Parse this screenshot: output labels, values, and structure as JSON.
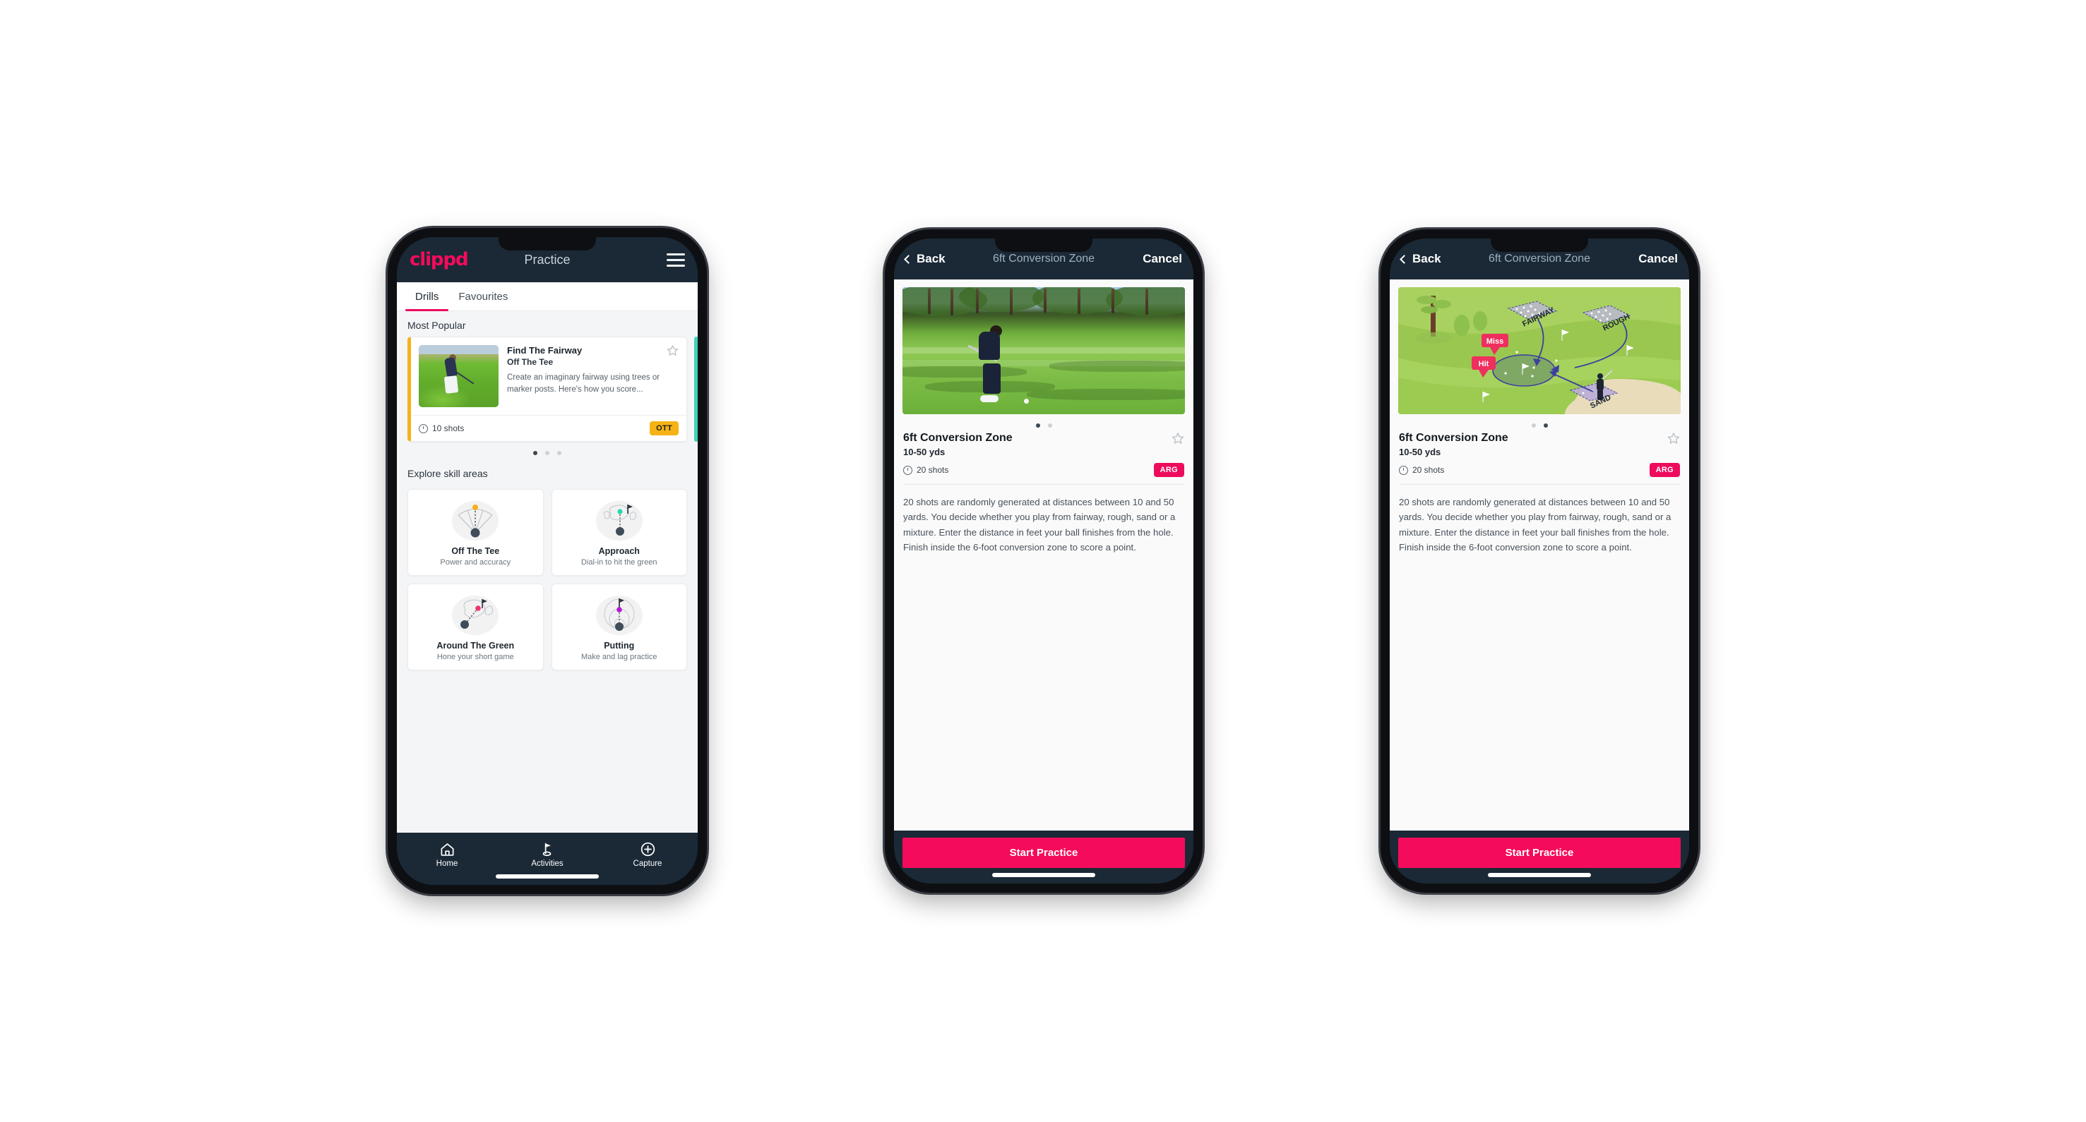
{
  "app": {
    "brand": "clippd",
    "title": "Practice",
    "accent_pink": "#f50b5b",
    "header_navy": "#1b2936",
    "badge_yellow": "#f6b316",
    "badge_pink": "#ee0b5d",
    "teal": "#3fd2b6"
  },
  "phone1": {
    "appbar": {
      "logo": "clippd",
      "title": "Practice",
      "menu_icon": "hamburger-icon"
    },
    "tabs": [
      {
        "label": "Drills",
        "active": true
      },
      {
        "label": "Favourites",
        "active": false
      }
    ],
    "most_popular": {
      "heading": "Most Popular",
      "card": {
        "name": "Find The Fairway",
        "category": "Off The Tee",
        "description": "Create an imaginary fairway using trees or marker posts. Here's how you score...",
        "shots": "10 shots",
        "badge": "OTT",
        "favourite_icon": "star-outline-icon",
        "accent": "#f5b21a"
      },
      "pagination": {
        "count": 3,
        "active_index": 0
      }
    },
    "skills": {
      "heading": "Explore skill areas",
      "items": [
        {
          "name": "Off The Tee",
          "sub": "Power and accuracy",
          "icon": "tee-fan-icon",
          "dot_color": "#f7ae18"
        },
        {
          "name": "Approach",
          "sub": "Dial-in to hit the green",
          "icon": "green-target-icon",
          "dot_color": "#27d8b0"
        },
        {
          "name": "Around The Green",
          "sub": "Hone your short game",
          "icon": "chip-green-icon",
          "dot_color": "#f0336b"
        },
        {
          "name": "Putting",
          "sub": "Make and lag practice",
          "icon": "putt-rings-icon",
          "dot_color": "#b41ad6"
        }
      ]
    },
    "tabbar": [
      {
        "label": "Home",
        "icon": "home-icon",
        "active": false
      },
      {
        "label": "Activities",
        "icon": "golf-flag-icon",
        "active": true
      },
      {
        "label": "Capture",
        "icon": "plus-circle-icon",
        "active": false
      }
    ]
  },
  "phone2": {
    "navbar": {
      "back": "Back",
      "title": "6ft Conversion Zone",
      "cancel": "Cancel",
      "back_icon": "chevron-left-icon"
    },
    "media": {
      "type": "video-still",
      "alt": "golfer chipping on fairway"
    },
    "pagination": {
      "count": 2,
      "active_index": 0
    },
    "detail": {
      "title": "6ft Conversion Zone",
      "subtitle": "10-50 yds",
      "shots": "20 shots",
      "badge": "ARG",
      "favourite_icon": "star-outline-icon",
      "description": "20 shots are randomly generated at distances between 10 and 50 yards. You decide whether you play from fairway, rough, sand or a mixture. Enter the distance in feet your ball finishes from the hole. Finish inside the 6-foot conversion zone to score a point."
    },
    "cta": "Start Practice"
  },
  "phone3": {
    "navbar": {
      "back": "Back",
      "title": "6ft Conversion Zone",
      "cancel": "Cancel",
      "back_icon": "chevron-left-icon"
    },
    "media": {
      "type": "course-illustration",
      "zone_labels": [
        "FAIRWAY",
        "ROUGH",
        "SAND"
      ],
      "markers": [
        "Miss",
        "Hit"
      ]
    },
    "pagination": {
      "count": 2,
      "active_index": 1
    },
    "detail": {
      "title": "6ft Conversion Zone",
      "subtitle": "10-50 yds",
      "shots": "20 shots",
      "badge": "ARG",
      "favourite_icon": "star-outline-icon",
      "description": "20 shots are randomly generated at distances between 10 and 50 yards. You decide whether you play from fairway, rough, sand or a mixture. Enter the distance in feet your ball finishes from the hole. Finish inside the 6-foot conversion zone to score a point."
    },
    "cta": "Start Practice"
  }
}
